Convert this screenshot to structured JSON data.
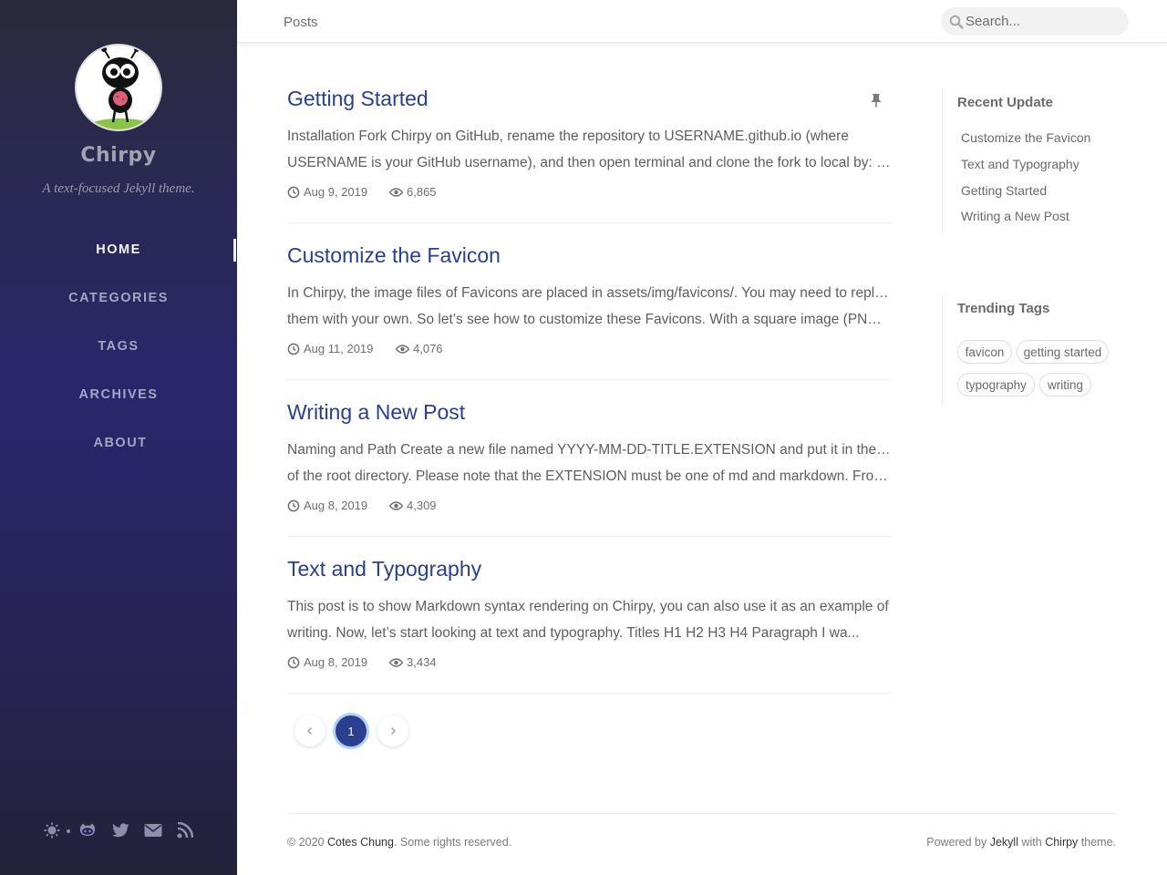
{
  "sidebar": {
    "title": "Chirpy",
    "subtitle": "A text-focused Jekyll theme.",
    "nav": [
      {
        "label": "HOME",
        "active": true
      },
      {
        "label": "CATEGORIES",
        "active": false
      },
      {
        "label": "TAGS",
        "active": false
      },
      {
        "label": "ARCHIVES",
        "active": false
      },
      {
        "label": "ABOUT",
        "active": false
      }
    ],
    "bottom_icons": [
      "theme-toggle-icon",
      "github-icon",
      "twitter-icon",
      "email-icon",
      "rss-icon"
    ]
  },
  "topbar": {
    "breadcrumb": "Posts",
    "search_placeholder": "Search..."
  },
  "posts": [
    {
      "title": "Getting Started",
      "excerpt_line1": "Installation Fork Chirpy on GitHub, rename the repository to USERNAME.github.io (where",
      "excerpt_line2": "USERNAME is your GitHub username), and then open terminal and clone the fork to local by: $ …",
      "date": "Aug 9, 2019",
      "views": "6,865",
      "pinned": true
    },
    {
      "title": "Customize the Favicon",
      "excerpt_line1": "In Chirpy, the image files of Favicons are placed in assets/img/favicons/. You may need to replace",
      "excerpt_line2": "them with your own. So let’s see how to customize these Favicons. With a square image (PNG,…",
      "date": "Aug 11, 2019",
      "views": "4,076",
      "pinned": false
    },
    {
      "title": "Writing a New Post",
      "excerpt_line1": "Naming and Path Create a new file named YYYY-MM-DD-TITLE.EXTENSION and put it in the _post/",
      "excerpt_line2": "of the root directory. Please note that the EXTENSION must be one of md and markdown. From…",
      "date": "Aug 8, 2019",
      "views": "4,309",
      "pinned": false
    },
    {
      "title": "Text and Typography",
      "excerpt_line1": "This post is to show Markdown syntax rendering on Chirpy, you can also use it as an example of",
      "excerpt_line2": "writing. Now, let’s start looking at text and typography. Titles H1 H2 H3 H4 Paragraph I wa...",
      "date": "Aug 8, 2019",
      "views": "3,434",
      "pinned": false
    }
  ],
  "pagination": {
    "current": "1"
  },
  "recent_update": {
    "heading": "Recent Update",
    "items": [
      "Customize the Favicon",
      "Text and Typography",
      "Getting Started",
      "Writing a New Post"
    ]
  },
  "trending_tags": {
    "heading": "Trending Tags",
    "tags": [
      "favicon",
      "getting started",
      "typography",
      "writing"
    ]
  },
  "footer": {
    "copyright_prefix": "© 2020 ",
    "author": "Cotes Chung",
    "copyright_suffix": ". Some rights reserved.",
    "powered_prefix": "Powered by ",
    "jekyll": "Jekyll",
    "with_text": " with ",
    "chirpy": "Chirpy",
    "theme_suffix": " theme."
  },
  "colors": {
    "link": "#2a408e",
    "sidebar_top": "#2a2a3c",
    "sidebar_mid": "#29276c",
    "active_page": "#2a408e"
  }
}
